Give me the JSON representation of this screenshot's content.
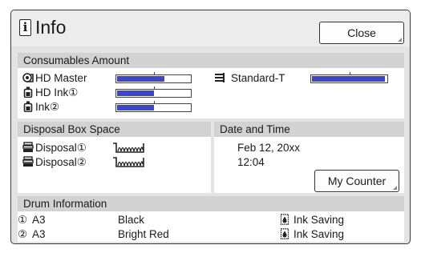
{
  "header": {
    "info_glyph": "i",
    "title": "Info",
    "close_label": "Close"
  },
  "consumables": {
    "heading": "Consumables Amount",
    "items": [
      {
        "label": "HD Master",
        "icon": "master-roll-icon",
        "level": 0.65
      },
      {
        "label": "HD Ink①",
        "icon": "ink-bottle-icon",
        "level": 0.5
      },
      {
        "label": "Ink②",
        "icon": "ink-bottle-icon",
        "level": 0.5
      },
      {
        "label": "Standard-T",
        "icon": "paper-stack-icon",
        "level": 0.98
      }
    ],
    "bar_color": "#3b47c7"
  },
  "disposal": {
    "heading": "Disposal Box Space",
    "items": [
      {
        "label": "Disposal①",
        "icon": "disposal-box-icon"
      },
      {
        "label": "Disposal②",
        "icon": "disposal-box-icon"
      }
    ]
  },
  "datetime": {
    "heading": "Date and Time",
    "date": "Feb 12, 20xx",
    "time": "12:04",
    "counter_label": "My Counter"
  },
  "drum": {
    "heading": "Drum Information",
    "rows": [
      {
        "num": "①",
        "size": "A3",
        "color": "Black",
        "mode": "Ink Saving",
        "mode_icon": "ink-saving-icon"
      },
      {
        "num": "②",
        "size": "A3",
        "color": "Bright Red",
        "mode": "Ink Saving",
        "mode_icon": "ink-saving-icon"
      }
    ]
  }
}
